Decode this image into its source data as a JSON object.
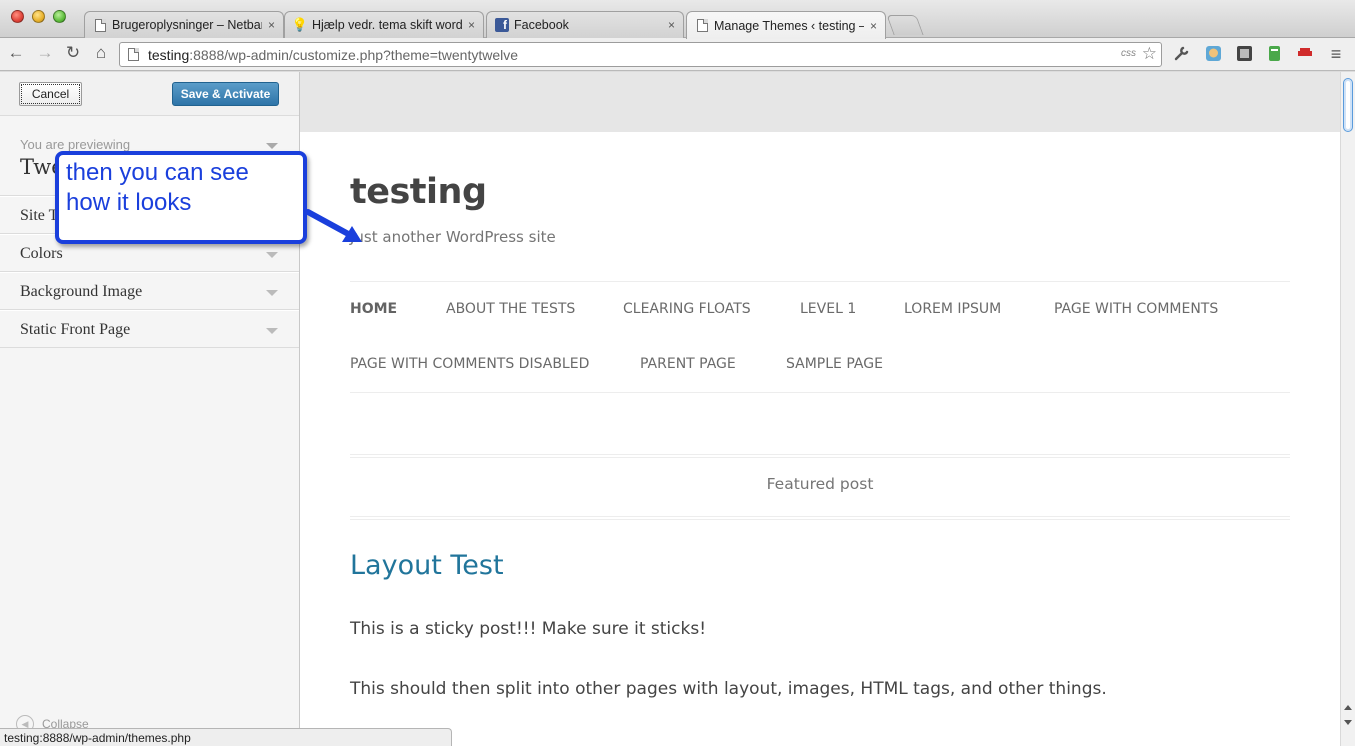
{
  "browser": {
    "tabs": [
      {
        "title": "Brugeroplysninger – Netbank",
        "icon": "document-icon",
        "close": "×"
      },
      {
        "title": "Hjælp vedr. tema skift wordp",
        "icon": "lightbulb-icon",
        "close": "×"
      },
      {
        "title": "Facebook",
        "icon": "facebook-icon",
        "close": "×"
      },
      {
        "title": "Manage Themes ‹ testing —",
        "icon": "document-icon",
        "close": "×"
      }
    ],
    "url_host": "testing",
    "url_rest": ":8888/wp-admin/customize.php?theme=twentytwelve",
    "css_badge": "css"
  },
  "sidebar": {
    "cancel_label": "Cancel",
    "save_label": "Save & Activate",
    "previewing_label": "You are previewing",
    "theme_name": "Twe",
    "sections": [
      {
        "label": "Site T"
      },
      {
        "label": "Colors"
      },
      {
        "label": "Background Image"
      },
      {
        "label": "Static Front Page"
      }
    ],
    "collapse_label": "Collapse"
  },
  "status_url": "testing:8888/wp-admin/themes.php",
  "site": {
    "title": "testing",
    "description": "Just another WordPress site",
    "nav": [
      {
        "label": "HOME",
        "current": true
      },
      {
        "label": "ABOUT THE TESTS"
      },
      {
        "label": "CLEARING FLOATS"
      },
      {
        "label": "LEVEL 1"
      },
      {
        "label": "LOREM IPSUM"
      },
      {
        "label": "PAGE WITH COMMENTS"
      },
      {
        "label": "PAGE WITH COMMENTS DISABLED"
      },
      {
        "label": "PARENT PAGE"
      },
      {
        "label": "SAMPLE PAGE"
      }
    ],
    "featured_label": "Featured post",
    "post_title": "Layout Test",
    "paragraphs": [
      "This is a sticky post!!! Make sure it sticks!",
      "This should then split into other pages with layout, images, HTML tags, and other things."
    ]
  },
  "annotation": {
    "line1": "then you can see",
    "line2": "how it looks",
    "color": "#1a3fdc"
  },
  "colors": {
    "wp_blue_button": "#2e74a8",
    "post_title_link": "#21759b"
  }
}
